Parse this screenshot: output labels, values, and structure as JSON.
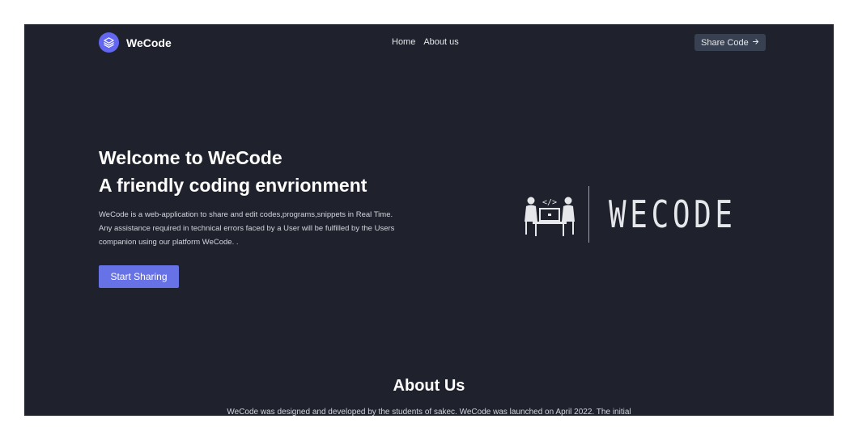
{
  "nav": {
    "brand": "WeCode",
    "logo_icon": "layers-icon",
    "links": [
      "Home",
      "About us"
    ],
    "share_label": "Share Code",
    "share_icon": "arrow-right-icon"
  },
  "hero": {
    "title_line1": "Welcome to WeCode",
    "title_line2": "A friendly coding envrionment",
    "desc_line1": "WeCode is a web-application to share and edit codes,programs,snippets in Real Time.",
    "desc_line2": "Any assistance required in technical errors faced by a User will be fulfilled by the Users",
    "desc_line3": "companion using our platform WeCode. .",
    "cta_label": "Start Sharing",
    "illustration_icon": "people-coding-icon",
    "illustration_code_symbol": "</>",
    "brand_word": "WECODE"
  },
  "about": {
    "title": "About Us",
    "text": "WeCode was designed and developed by the students of sakec. WeCode was launched on April 2022. The initial"
  },
  "colors": {
    "background": "#1f222d",
    "accent": "#6672e5",
    "logo": "#6366f1",
    "secondary_button": "#374151"
  }
}
